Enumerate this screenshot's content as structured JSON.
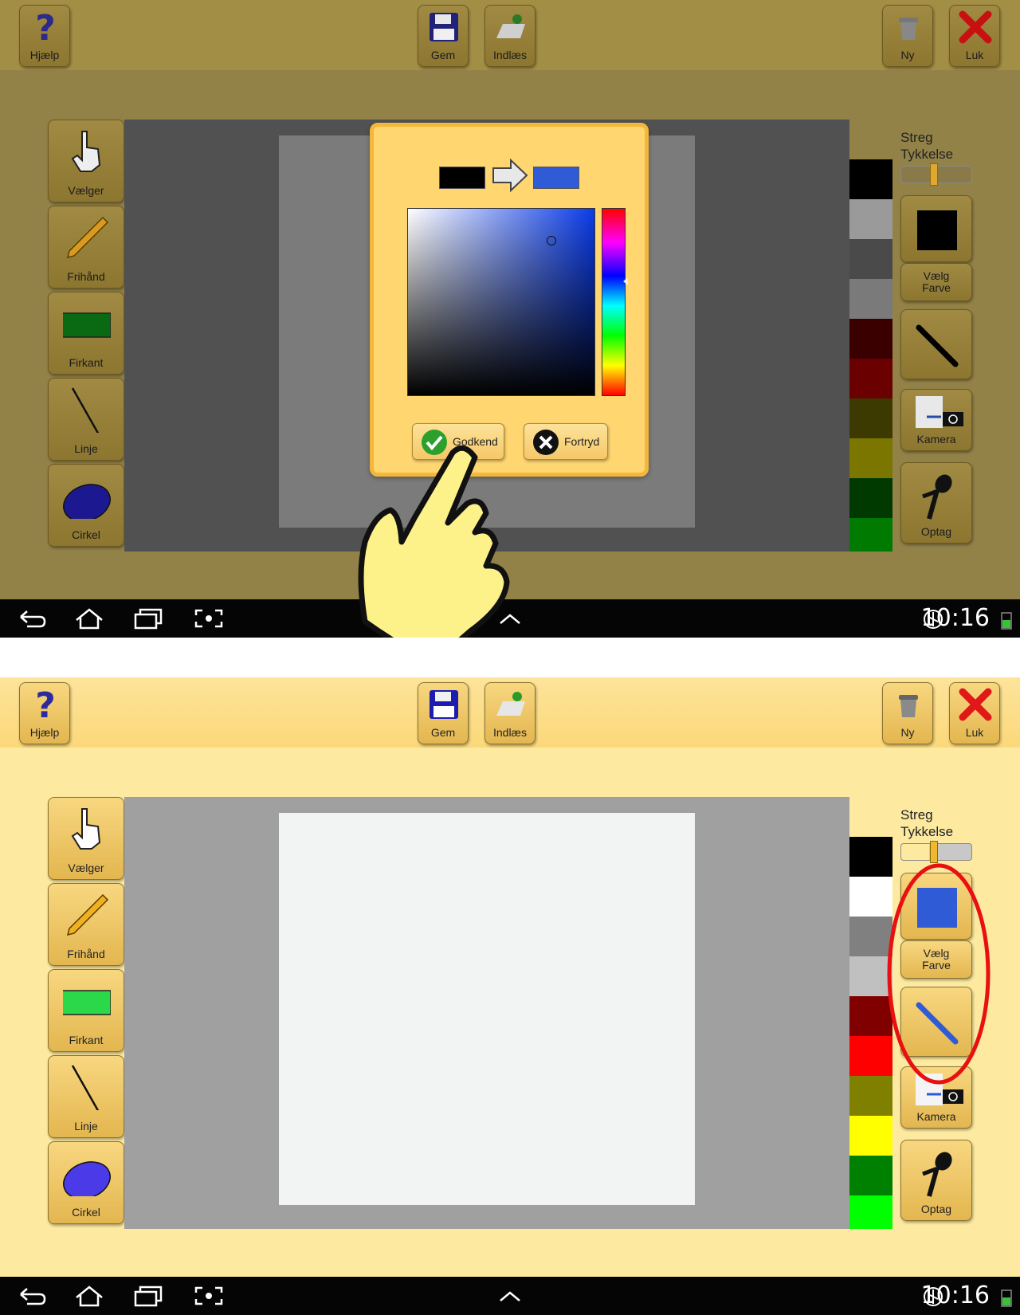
{
  "toolbar": {
    "help_label": "Hjælp",
    "save_label": "Gem",
    "load_label": "Indlæs",
    "new_label": "Ny",
    "close_label": "Luk"
  },
  "tools": [
    {
      "label": "Vælger",
      "icon": "hand-pointer-icon"
    },
    {
      "label": "Frihånd",
      "icon": "pencil-icon"
    },
    {
      "label": "Firkant",
      "icon": "rectangle-icon"
    },
    {
      "label": "Linje",
      "icon": "line-icon"
    },
    {
      "label": "Cirkel",
      "icon": "ellipse-icon"
    }
  ],
  "right_panel": {
    "stroke_label_line1": "Streg",
    "stroke_label_line2": "Tykkelse",
    "choose_color_line1": "Vælg",
    "choose_color_line2": "Farve",
    "camera_label": "Kamera",
    "record_label": "Optag"
  },
  "palette_top": [
    "#000000",
    "#9a9a9a",
    "#4a4a4a",
    "#7a7a7a",
    "#3a0000",
    "#6a0000",
    "#3c3a00",
    "#7a7600",
    "#003a00",
    "#007a00"
  ],
  "palette_bottom": [
    "#000000",
    "#ffffff",
    "#808080",
    "#c0c0c0",
    "#800000",
    "#ff0000",
    "#808000",
    "#ffff00",
    "#008000",
    "#00ff00"
  ],
  "color_dialog": {
    "old_color": "#000000",
    "new_color": "#2f5bd6",
    "hue_color": "#0a3be8",
    "ok_label": "Godkend",
    "cancel_label": "Fortryd"
  },
  "current_color_top": "#000000",
  "current_color_bottom": "#2f5bd6",
  "status": {
    "time_top": "10:16",
    "time_bottom": "10:16"
  }
}
